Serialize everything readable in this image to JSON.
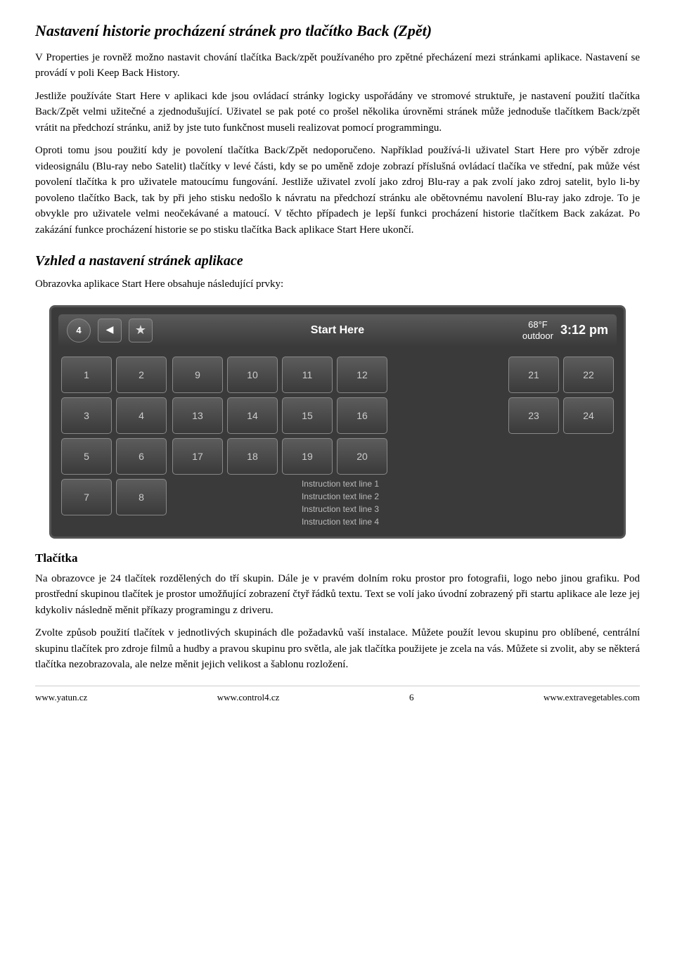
{
  "page": {
    "title": "Nastavení historie procházení stránek pro tlačítko Back (Zpět)",
    "paragraphs": [
      "V Properties je rovněž možno nastavit chování tlačítka Back/zpět používaného pro zpětné přecházení mezi stránkami aplikace. Nastavení se provádí v poli Keep Back History.",
      "Jestliže používáte Start Here v aplikaci kde jsou ovládací stránky logicky uspořádány ve stromové struktuře, je nastavení použití tlačítka Back/Zpět velmi užitečné a zjednodušující. Uživatel se pak poté co prošel několika úrovněmi stránek může jednoduše tlačítkem Back/zpět vrátit na předchozí stránku, aniž by jste tuto funkčnost museli realizovat pomocí programmingu.",
      "Oproti tomu jsou použití kdy je povolení tlačítka Back/Zpět nedoporučeno. Například používá-li uživatel Start Here pro výběr zdroje videosignálu (Blu-ray nebo Satelit) tlačítky v levé části, kdy se po uměně zdoje zobrazí příslušná ovládací tlačíka ve střední, pak může vést povolení tlačítka k pro uživatele matoucímu fungování. Jestliže uživatel zvolí jako zdroj Blu-ray a pak zvolí jako zdroj satelit, bylo li-by povoleno tlačítko Back, tak by při jeho stisku nedošlo k návratu na předchozí stránku ale obětovnému navolení Blu-ray jako zdroje. To je obvykle pro uživatele velmi neočekávané a matoucí. V těchto případech je lepší funkci procházení historie tlačítkem Back zakázat. Po zakázání funkce procházení historie se po stisku tlačítka Back aplikace Start Here ukončí."
    ],
    "section2_title": "Vzhled a nastavení stránek aplikace",
    "section2_intro": "Obrazovka aplikace Start Here obsahuje následující prvky:",
    "section3_title": "Tlačítka",
    "section3_paragraphs": [
      "Na obrazovce je 24 tlačítek rozdělených do tří skupin. Dále je v pravém dolním roku prostor pro fotografii, logo nebo jinou grafiku. Pod prostřední skupinou tlačítek je prostor umožňující zobrazení čtyř řádků textu. Text se volí jako úvodní zobrazený při startu aplikace ale leze jej kdykoliv následně měnit příkazy programingu z driveru.",
      "Zvolte způsob použití tlačítek v jednotlivých skupinách dle požadavků vaší instalace. Můžete použít levou skupinu pro oblíbené, centrální skupinu tlačítek pro zdroje filmů a hudby a pravou skupinu pro světla, ale jak tlačítka použijete je zcela na vás. Můžete si zvolit, aby se některá tlačítka nezobrazovala, ale nelze měnit jejich velikost a šablonu rozložení."
    ]
  },
  "ui": {
    "topbar": {
      "channel_btn": "4",
      "back_btn": "◀",
      "star_btn": "★",
      "title": "Start Here",
      "weather_temp": "68°F",
      "weather_label": "outdoor",
      "time": "3:12 pm"
    },
    "groups": [
      {
        "label": "left",
        "rows": [
          [
            "1",
            "2"
          ],
          [
            "3",
            "4"
          ],
          [
            "5",
            "6"
          ],
          [
            "7",
            "8"
          ]
        ]
      },
      {
        "label": "center",
        "rows": [
          [
            "9",
            "10",
            "11",
            "12"
          ],
          [
            "13",
            "14",
            "15",
            "16"
          ],
          [
            "17",
            "18",
            "19",
            "20"
          ]
        ],
        "instructions": [
          "Instruction text line 1",
          "Instruction text line 2",
          "Instruction text line 3",
          "Instruction text line 4"
        ]
      },
      {
        "label": "right",
        "rows": [
          [
            "21",
            "22"
          ],
          [
            "23",
            "24"
          ]
        ]
      }
    ]
  },
  "footer": {
    "left": "www.yatun.cz",
    "center_left": "www.control4.cz",
    "page_number": "6",
    "right": "www.extravegetables.com"
  }
}
